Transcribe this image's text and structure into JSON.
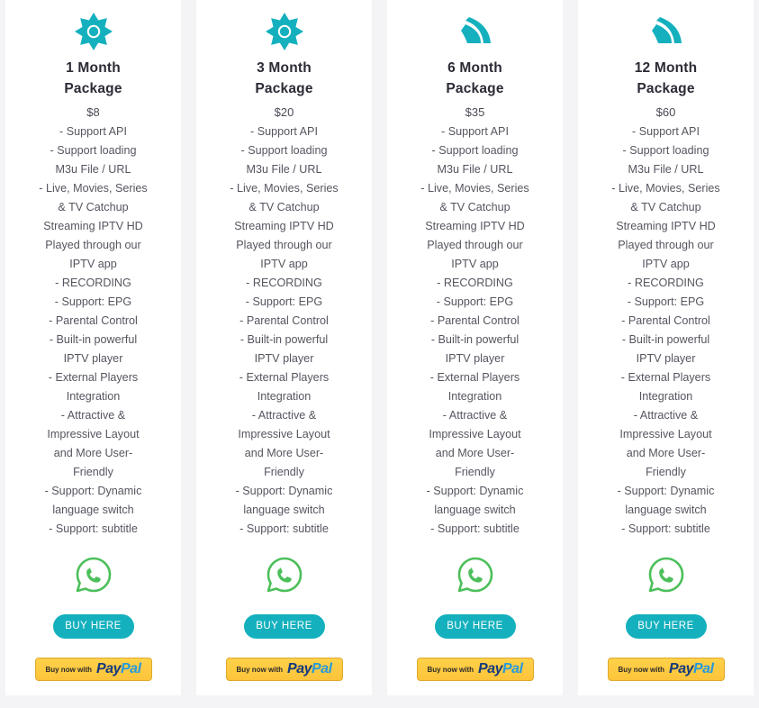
{
  "theme": {
    "page_bg": "#f4f4f6",
    "card_bg": "#ffffff",
    "accent_teal": "#14b0bd",
    "whatsapp_green": "#4cbf5a",
    "paypal_yellow": "#ffd14a",
    "paypal_blue_dark": "#14397d",
    "paypal_blue_light": "#279ada",
    "title_color": "#2b2b36",
    "feature_color": "#555560"
  },
  "shared": {
    "buy_here_label": "BUY HERE",
    "paypal_prefix": "Buy now with",
    "paypal_brand_part1": "Pay",
    "paypal_brand_part2": "Pal",
    "whatsapp_icon": "whatsapp-icon",
    "features": [
      "- Support API",
      "- Support loading",
      "M3u File / URL",
      "- Live, Movies, Series",
      "& TV Catchup",
      "Streaming IPTV HD",
      "Played through our",
      "IPTV app",
      "- RECORDING",
      "- Support: EPG",
      "- Parental Control",
      "- Built-in powerful",
      "IPTV player",
      "- External Players",
      "Integration",
      "- Attractive &",
      "Impressive Layout",
      "and More User-",
      "Friendly",
      "- Support: Dynamic",
      "language switch",
      "- Support: subtitle"
    ]
  },
  "plans": [
    {
      "icon": "sun-gear-icon",
      "title_line1": "1 Month",
      "title_line2": "Package",
      "price": "$8"
    },
    {
      "icon": "sun-gear-icon",
      "title_line1": "3 Month",
      "title_line2": "Package",
      "price": "$20"
    },
    {
      "icon": "wave-fin-icon",
      "title_line1": "6 Month",
      "title_line2": "Package",
      "price": "$35"
    },
    {
      "icon": "wave-fin-icon",
      "title_line1": "12 Month",
      "title_line2": "Package",
      "price": "$60"
    }
  ]
}
